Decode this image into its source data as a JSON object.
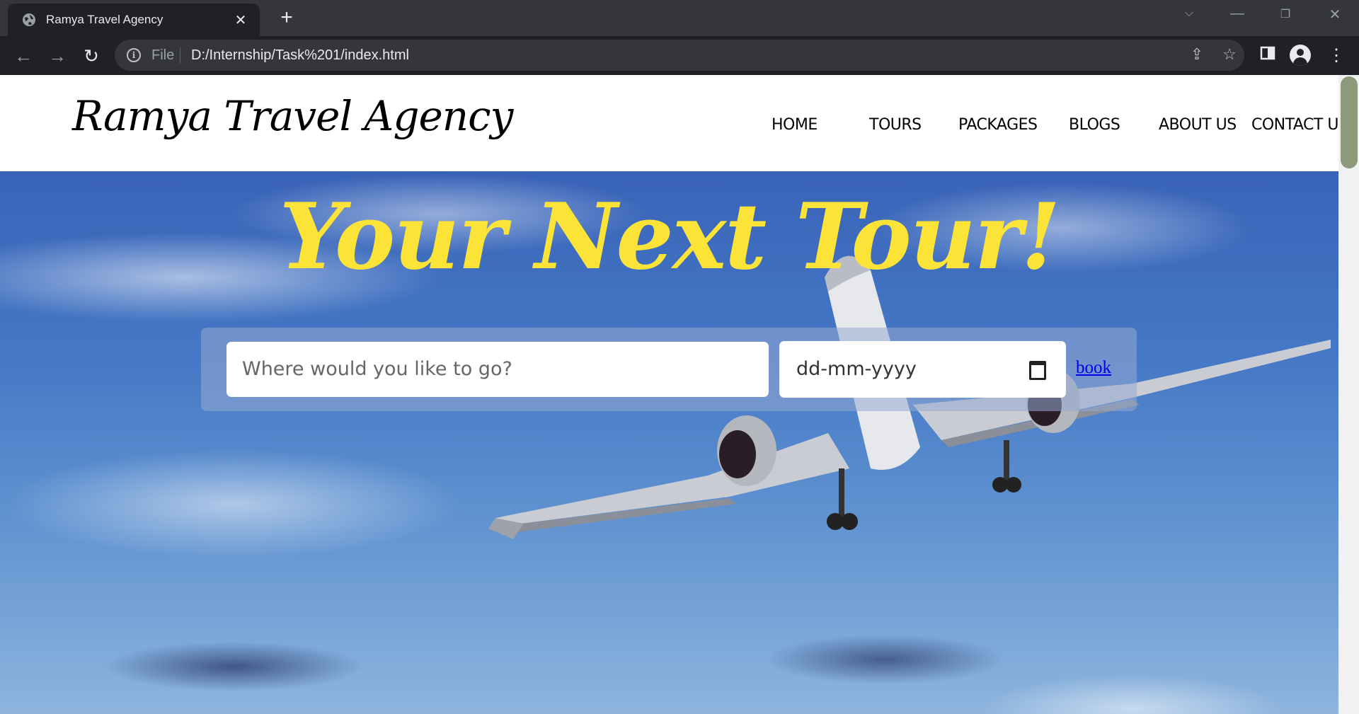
{
  "browser": {
    "tab_title": "Ramya Travel Agency",
    "new_tab": "+",
    "scheme_label": "File",
    "url": "D:/Internship/Task%201/index.html",
    "icons": [
      "globe-icon",
      "close-icon",
      "back-icon",
      "forward-icon",
      "reload-icon",
      "info-icon",
      "share-icon",
      "star-icon",
      "side-panel-icon",
      "profile-icon",
      "menu-icon",
      "chevron-down-icon",
      "minimize-icon",
      "restore-icon",
      "window-close-icon"
    ]
  },
  "site": {
    "logo": "Ramya Travel Agency",
    "nav": [
      "HOME",
      "TOURS",
      "PACKAGES",
      "BLOGS",
      "ABOUT US",
      "CONTACT US"
    ]
  },
  "hero": {
    "title": "Your Next Tour!",
    "destination_placeholder": "Where would you like to go?",
    "date_placeholder": "dd-mm-yyyy",
    "book_label": "book",
    "title_color": "#fbe337"
  }
}
